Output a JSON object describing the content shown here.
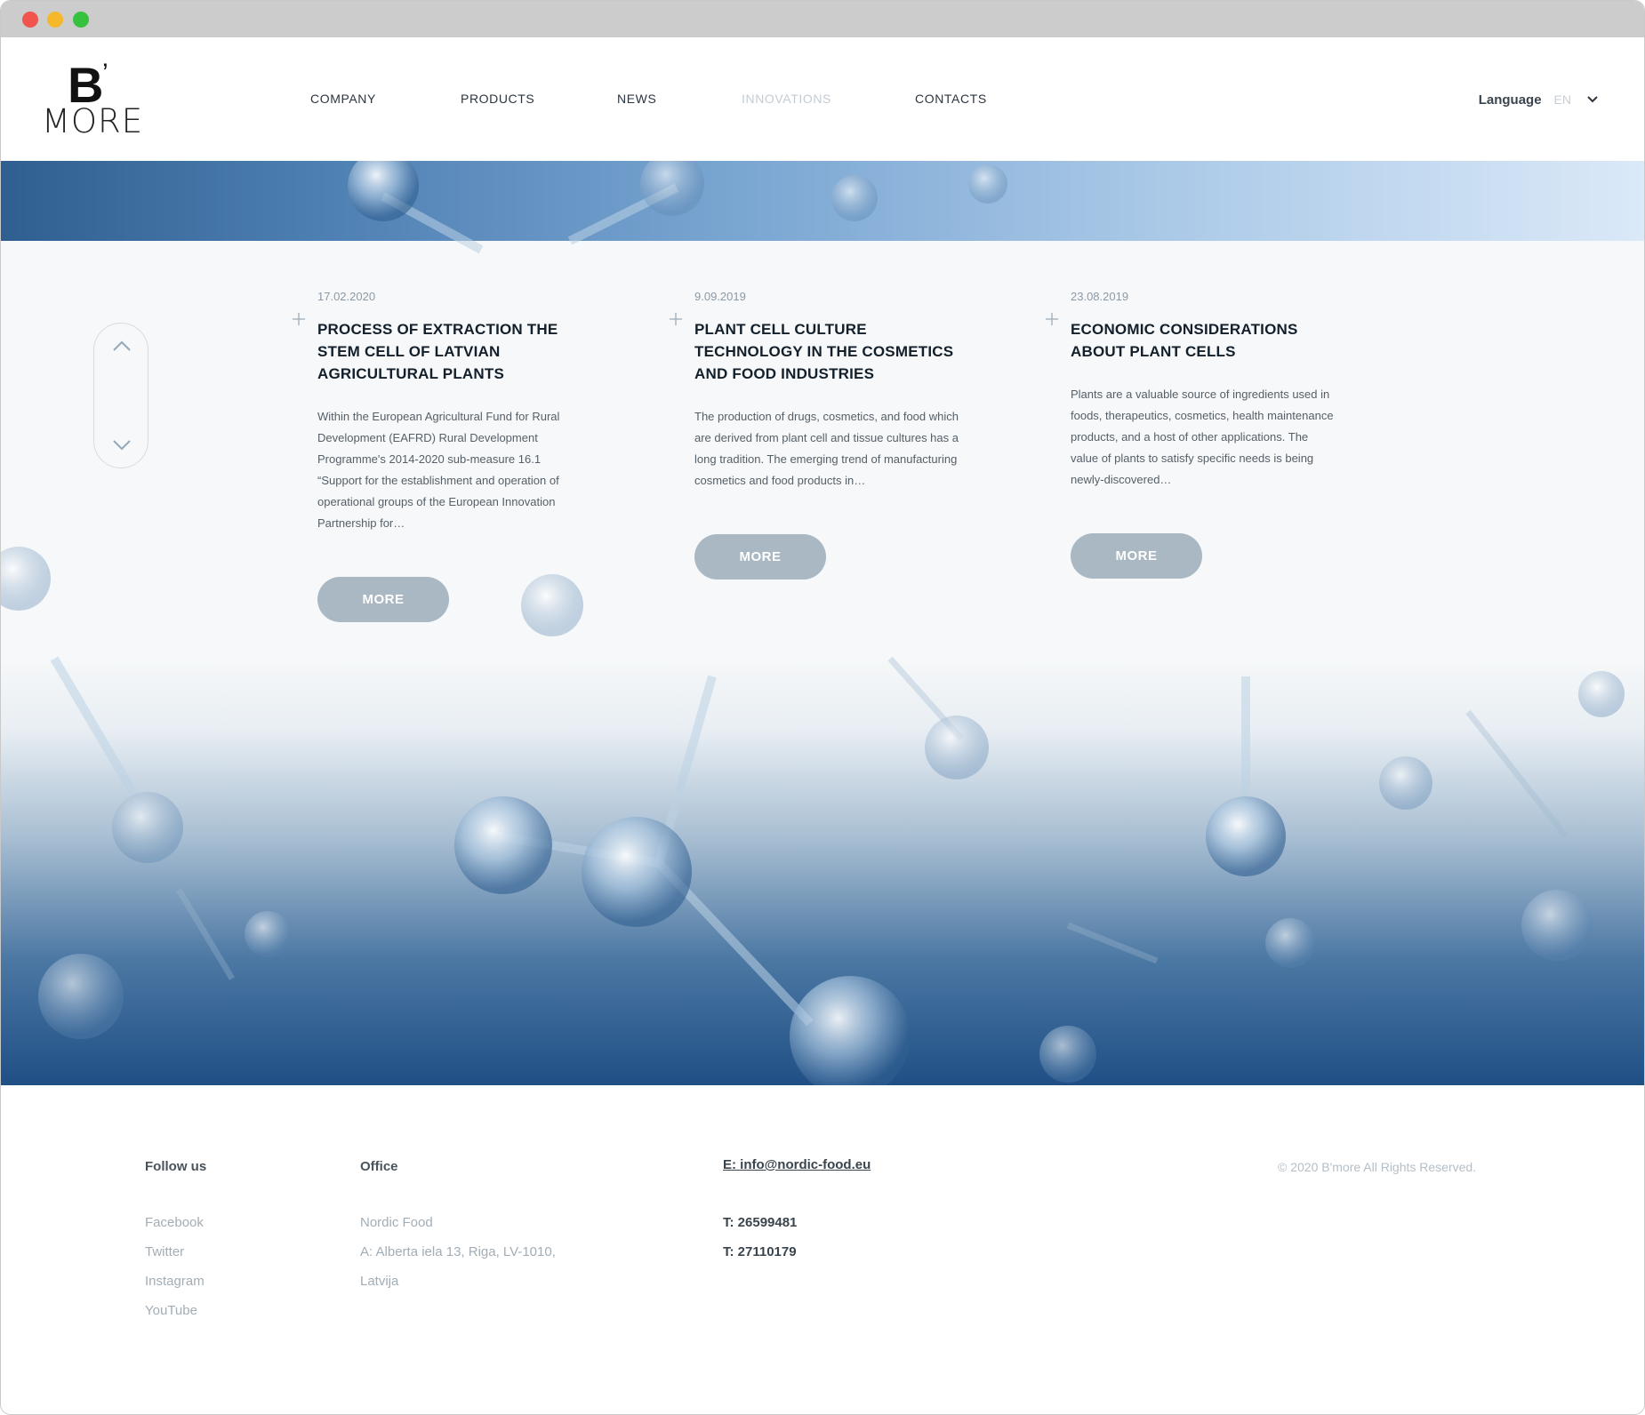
{
  "window": {
    "title": ""
  },
  "brand": {
    "logo_letter": "B",
    "logo_mark": "’",
    "logo_word": "MORE"
  },
  "nav": {
    "items": [
      {
        "label": "COMPANY",
        "state": "normal"
      },
      {
        "label": "PRODUCTS",
        "state": "normal"
      },
      {
        "label": "NEWS",
        "state": "normal"
      },
      {
        "label": "INNOVATIONS",
        "state": "active-dim"
      },
      {
        "label": "CONTACTS",
        "state": "normal"
      }
    ]
  },
  "language": {
    "label": "Language",
    "selected": "EN",
    "icon": "chevron-down-icon"
  },
  "scroller": {
    "up_icon": "chevron-up-icon",
    "down_icon": "chevron-down-icon"
  },
  "news": [
    {
      "date": "17.02.2020",
      "title": "PROCESS OF EXTRACTION THE STEM CELL OF LATVIAN AGRICULTURAL PLANTS",
      "excerpt": "Within the European Agricultural Fund for Rural Development (EAFRD) Rural Development Programme's 2014-2020 sub-measure 16.1 “Support for the establishment and operation of operational groups of the European Innovation Partnership for…",
      "button": "MORE"
    },
    {
      "date": "9.09.2019",
      "title": "PLANT CELL CULTURE TECHNOLOGY IN THE COSMETICS AND FOOD INDUSTRIES",
      "excerpt": "The production of drugs, cosmetics, and food which are derived from plant cell and tissue cultures has a long tradition. The emerging trend of manufacturing cosmetics and food products in…",
      "button": "MORE"
    },
    {
      "date": "23.08.2019",
      "title": "ECONOMIC CONSIDERATIONS ABOUT PLANT CELLS",
      "excerpt": "Plants are a valuable source of ingredients used in foods, therapeutics, cosmetics, health maintenance products, and a host of other applications. The value of plants to satisfy specific needs is being newly-discovered…",
      "button": "MORE"
    }
  ],
  "footer": {
    "follow": {
      "heading": "Follow us",
      "links": [
        "Facebook",
        "Twitter",
        "Instagram",
        "YouTube"
      ]
    },
    "office": {
      "heading": "Office",
      "lines": [
        "Nordic Food",
        "A: Alberta iela 13, Riga, LV-1010,",
        "Latvija"
      ]
    },
    "contact": {
      "email": "E: info@nordic-food.eu",
      "phones": [
        "T: 26599481",
        "T: 27110179"
      ]
    },
    "copyright": "© 2020 B'more All Rights Reserved."
  },
  "colors": {
    "button_bg": "#a9b8c2",
    "hero_dark": "#1f4f85",
    "muted_text": "#a2adb6"
  }
}
